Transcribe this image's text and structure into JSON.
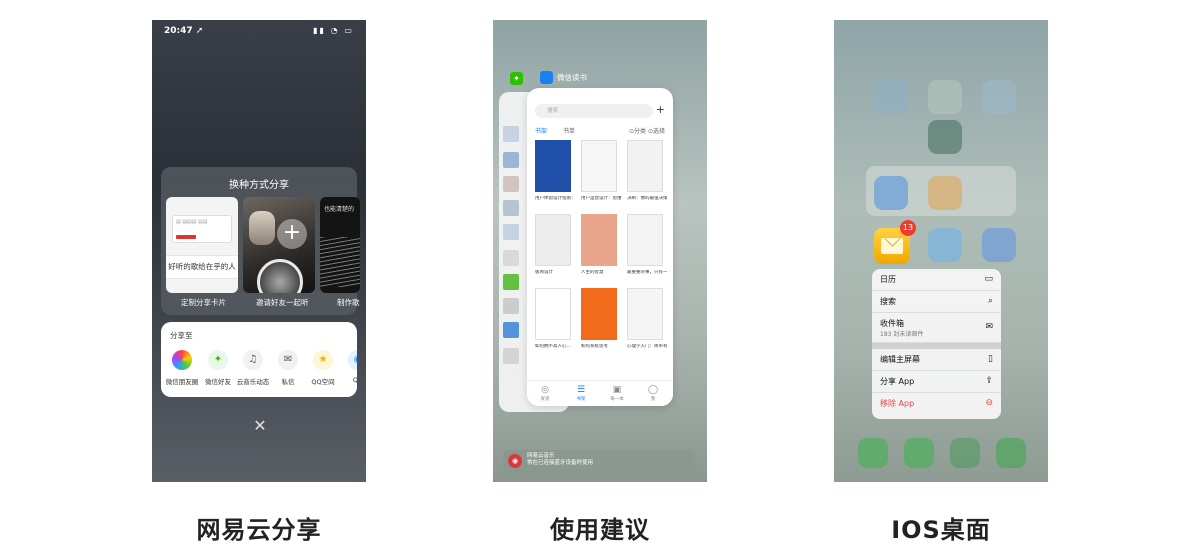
{
  "captions": [
    "网易云分享",
    "使用建议",
    "IOS桌面"
  ],
  "panel1": {
    "status_time": "20:47 ➚",
    "share_title": "换种方式分享",
    "options": [
      {
        "label": "定制分享卡片",
        "card_text": "好听的歌给在乎的人"
      },
      {
        "label": "邀请好友一起听"
      },
      {
        "label": "制作歌",
        "card_text": "也能清楚的"
      }
    ],
    "share_to_label": "分享至",
    "targets": [
      {
        "label": "微信朋友圈",
        "icon": "moments-icon"
      },
      {
        "label": "微信好友",
        "icon": "wechat-icon"
      },
      {
        "label": "云音乐动态",
        "icon": "music-dynamic-icon"
      },
      {
        "label": "私信",
        "icon": "message-icon"
      },
      {
        "label": "QQ空间",
        "icon": "qzone-icon"
      },
      {
        "label": "QQ",
        "icon": "qq-icon"
      }
    ],
    "close_glyph": "✕"
  },
  "panel2": {
    "app_name": "微信读书",
    "search_placeholder": "搜索",
    "add_glyph": "+",
    "tab_bookshelf": "书架",
    "tab_booklist": "书单",
    "right_actions": "⊙分类  ⊙选择",
    "books": [
      {
        "title": "用户体验设计指南：从方法论...",
        "color": "#1f4fa8"
      },
      {
        "title": "用户运营设计：思维与...",
        "color": "#f6f6f6"
      },
      {
        "title": "决断：像的最强决策...",
        "color": "#f2f2f2"
      },
      {
        "title": "极简设计",
        "color": "#ececec"
      },
      {
        "title": "人生的智慧",
        "color": "#e9a58a"
      },
      {
        "title": "最重要的事，只有一件",
        "color": "#f3f3f3"
      },
      {
        "title": "如何拥不高人心...",
        "color": "#ffffff"
      },
      {
        "title": "如何系统思考",
        "color": "#f26b1d"
      },
      {
        "title": "心理学入门：简单有...",
        "color": "#f5f5f5"
      }
    ],
    "nav": [
      "发现",
      "书架",
      "每一本",
      "我"
    ],
    "notice_title": "网易云音乐",
    "notice_text": "常在已连接蓝牙设备时使用"
  },
  "panel3": {
    "badge_count": "13",
    "menu": [
      {
        "label": "日历",
        "icon": "▭"
      },
      {
        "label": "搜索",
        "icon": "⌕"
      },
      {
        "label": "收件箱",
        "sub": "183 封未读邮件",
        "icon": "✉"
      },
      {
        "label": "编辑主屏幕",
        "icon": "▯"
      },
      {
        "label": "分享 App",
        "icon": "⇪"
      },
      {
        "label": "移除 App",
        "icon": "⊖"
      }
    ]
  }
}
